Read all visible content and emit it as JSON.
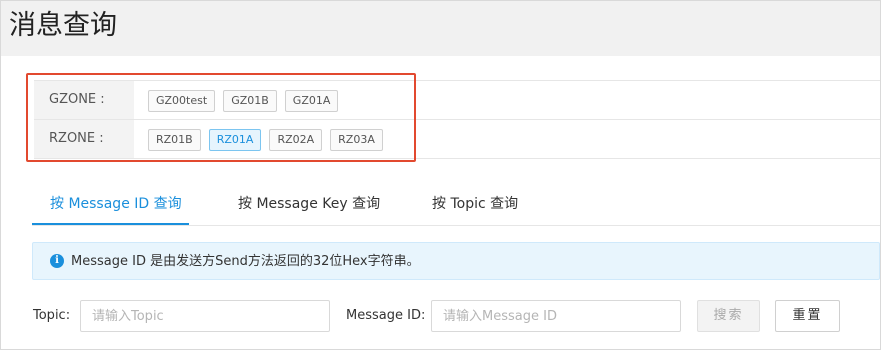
{
  "page": {
    "title": "消息查询"
  },
  "zones": {
    "gzone": {
      "label": "GZONE :",
      "tags": [
        "GZ00test",
        "GZ01B",
        "GZ01A"
      ]
    },
    "rzone": {
      "label": "RZONE :",
      "tags": [
        "RZ01B",
        "RZ01A",
        "RZ02A",
        "RZ03A"
      ],
      "selected": "RZ01A"
    }
  },
  "tabs": [
    {
      "label": "按 Message ID 查询",
      "active": true
    },
    {
      "label": "按 Message Key 查询",
      "active": false
    },
    {
      "label": "按 Topic 查询",
      "active": false
    }
  ],
  "info": {
    "icon": "info-icon",
    "text": "Message ID 是由发送方Send方法返回的32位Hex字符串。"
  },
  "form": {
    "topic_label": "Topic:",
    "topic_placeholder": "请输入Topic",
    "message_id_label": "Message ID:",
    "message_id_placeholder": "请输入Message ID",
    "search_button": "搜索",
    "reset_button": "重置"
  },
  "colors": {
    "accent": "#1a8fdc",
    "highlight_border": "#e2492f",
    "info_bg": "#e8f5fd"
  }
}
